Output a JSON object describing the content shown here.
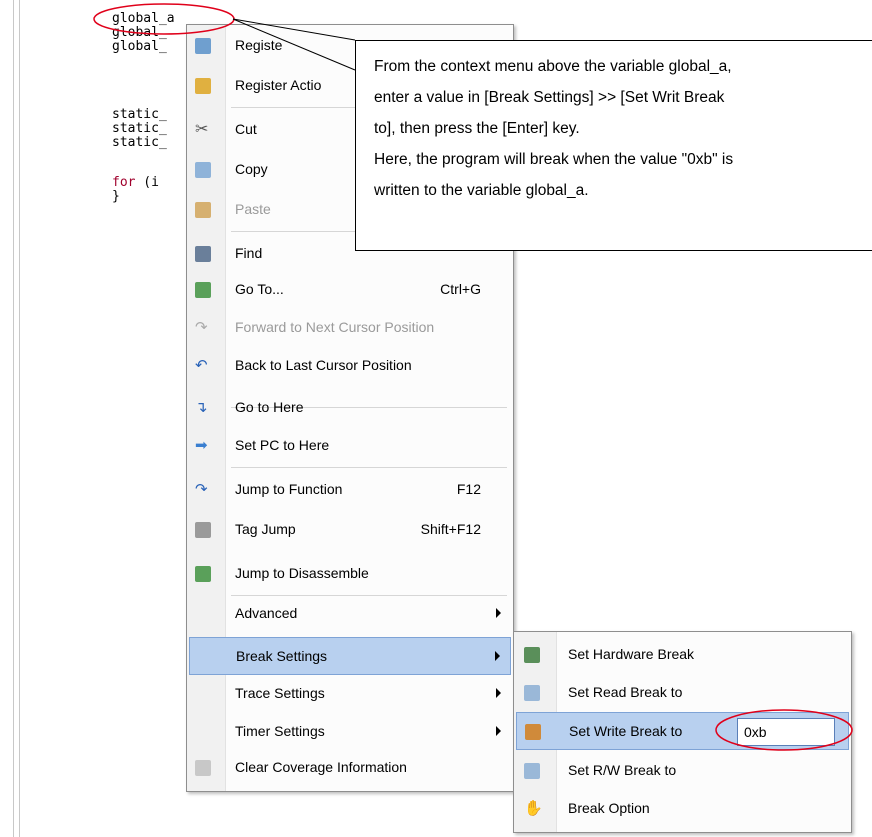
{
  "code": {
    "lines": [
      "global_a",
      "global_",
      "global_",
      "",
      "static_",
      "static_",
      "static_",
      "",
      "for (i",
      "}"
    ],
    "partial_lines": [
      "global_a",
      "global_",
      "global_",
      "static_",
      "static_",
      "static_"
    ],
    "for_keyword": "for",
    "for_rest": " (i",
    "brace": "}"
  },
  "context_menu": {
    "items": [
      {
        "label": "Register to Watch",
        "visible_label": "Registe",
        "icon": "watch-register-icon"
      },
      {
        "label": "Register Action Event",
        "visible_label": "Register Actio",
        "icon": "action-event-icon"
      },
      {
        "label": "Cut",
        "icon": "scissors-icon"
      },
      {
        "label": "Copy",
        "icon": "copy-icon"
      },
      {
        "label": "Paste",
        "icon": "paste-icon",
        "disabled": true
      },
      {
        "label": "Find",
        "icon": "binoculars-icon"
      },
      {
        "label": "Go To...",
        "shortcut": "Ctrl+G",
        "icon": "goto-icon"
      },
      {
        "label": "Forward to Next Cursor Position",
        "icon": "forward-arrow-icon",
        "disabled": true
      },
      {
        "label": "Back to Last Cursor Position",
        "icon": "back-arrow-icon"
      },
      {
        "label": "Go to Here",
        "icon": "go-to-here-icon"
      },
      {
        "label": "Set PC to Here",
        "icon": "set-pc-icon"
      },
      {
        "label": "Jump to Function",
        "shortcut": "F12",
        "icon": "jump-function-icon"
      },
      {
        "label": "Tag Jump",
        "shortcut": "Shift+F12",
        "icon": "tag-jump-icon"
      },
      {
        "label": "Jump to Disassemble",
        "icon": "jump-disassemble-icon"
      },
      {
        "label": "Advanced",
        "submenu": true
      },
      {
        "label": "Break Settings",
        "submenu": true,
        "selected": true
      },
      {
        "label": "Trace Settings",
        "submenu": true
      },
      {
        "label": "Timer Settings",
        "submenu": true
      },
      {
        "label": "Clear Coverage Information",
        "icon": "coverage-icon"
      }
    ]
  },
  "break_submenu": {
    "items": [
      {
        "label": "Set Hardware Break",
        "icon": "hardware-break-icon"
      },
      {
        "label": "Set Read Break to",
        "icon": "read-break-icon"
      },
      {
        "label": "Set Write Break to",
        "icon": "write-break-icon",
        "selected": true,
        "value": "0xb"
      },
      {
        "label": "Set R/W Break to",
        "icon": "rw-break-icon"
      },
      {
        "label": "Break Option",
        "icon": "break-option-icon"
      }
    ]
  },
  "callout": {
    "line1": "From the context menu above the variable global_a,",
    "line2": "enter a value in [Break Settings] >> [Set Writ Break",
    "line3": "to], then press the [Enter] key.",
    "line4": "Here, the program will break when the value \"0xb\" is",
    "line5": "written to the variable global_a."
  },
  "colors": {
    "highlight": "#b8d0ef",
    "annotation_circle": "#e0001a",
    "keyword": "#a0002c"
  }
}
